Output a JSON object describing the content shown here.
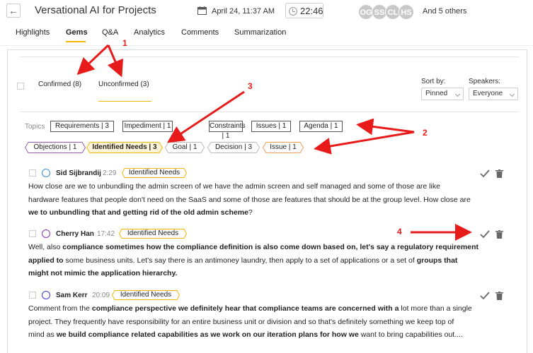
{
  "header": {
    "back_icon": "back-arrow-icon",
    "title": "Versational AI for Projects",
    "date": "April 24, 11:37 AM",
    "duration": "22:46",
    "participants": [
      "OG",
      "SS",
      "CL",
      "HS"
    ],
    "others": "And 5 others"
  },
  "tabs": [
    "Highlights",
    "Gems",
    "Q&A",
    "Analytics",
    "Comments",
    "Summarization"
  ],
  "active_tab": "Gems",
  "subtabs": {
    "confirmed": "Confirmed (8)",
    "unconfirmed": "Unconfirmed (3)"
  },
  "sort": {
    "label": "Sort by:",
    "value": "Pinned"
  },
  "speakers": {
    "label": "Speakers:",
    "value": "Everyone"
  },
  "topics": {
    "label": "Topics",
    "items": [
      "Requirements | 3",
      "Impediment | 1",
      "Constraints | 1",
      "Issues | 1",
      "Agenda | 1"
    ]
  },
  "gem_types": [
    "Objections | 1",
    "Identified Needs | 3",
    "Goal | 1",
    "Decision | 3",
    "Issue | 1"
  ],
  "gem_colors": {
    "objections": "#9b59b6",
    "identified_needs": "#f2b705",
    "goal": "#bbbbbb",
    "decision": "#bbbbbb",
    "issue": "#f0a05a"
  },
  "entries": [
    {
      "speaker": "Sid Sijbrandij",
      "time": "2:29",
      "tag": "Identified Needs",
      "circle_color": "#3b8de0",
      "text_lines": [
        [
          {
            "t": "How close are we to unbundling the admin screen of we have the admin screen and self managed and some of those are like",
            "b": false
          }
        ],
        [
          {
            "t": "hardware features that people don't need on the SaaS and some of those are features that should be at the group level. How close are",
            "b": false
          }
        ],
        [
          {
            "t": "we to unbundling that and getting rid of the old admin scheme",
            "b": true
          },
          {
            "t": "?",
            "b": false
          }
        ]
      ]
    },
    {
      "speaker": "Cherry Han",
      "time": "17:42",
      "tag": "Identified Needs",
      "circle_color": "#8e2fb5",
      "text_lines": [
        [
          {
            "t": "Well, also ",
            "b": false
          },
          {
            "t": "compliance sometimes how the compliance definition is also come down based on, let's say a regulatory requirement",
            "b": true
          }
        ],
        [
          {
            "t": "applied to",
            "b": true
          },
          {
            "t": " some business units. Let's say there is an antimoney laundry, then apply to a set of applications or a set of ",
            "b": false
          },
          {
            "t": "groups that",
            "b": true
          }
        ],
        [
          {
            "t": "might not mimic the application hierarchy.",
            "b": true
          }
        ]
      ]
    },
    {
      "speaker": "Sam Kerr",
      "time": "20:09",
      "tag": "Identified Needs",
      "circle_color": "#3b3be0",
      "text_lines": [
        [
          {
            "t": "Comment from the ",
            "b": false
          },
          {
            "t": "compliance perspective we definitely hear that compliance teams are concerned with a",
            "b": true
          },
          {
            "t": " lot more than a single",
            "b": false
          }
        ],
        [
          {
            "t": "project. They frequently have responsibility for an entire business unit or division and so that's definitely something we keep top of",
            "b": false
          }
        ],
        [
          {
            "t": "mind as ",
            "b": false
          },
          {
            "t": "we build compliance related capabilities as we work on our iteration plans for how we",
            "b": true
          },
          {
            "t": " want to bring capabilities out....",
            "b": false
          }
        ]
      ]
    }
  ],
  "annotations": {
    "numbers": [
      "1",
      "2",
      "3",
      "4"
    ],
    "color": "#e81b1b"
  }
}
